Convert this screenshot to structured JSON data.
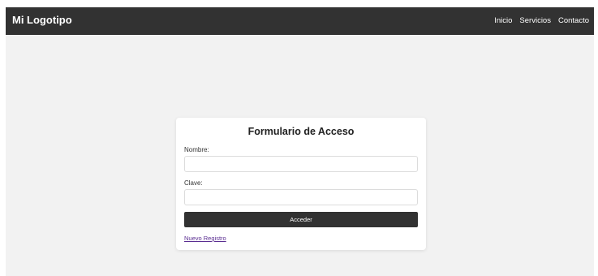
{
  "header": {
    "logo": "Mi Logotipo",
    "nav": [
      {
        "label": "Inicio"
      },
      {
        "label": "Servicios"
      },
      {
        "label": "Contacto"
      }
    ]
  },
  "form": {
    "title": "Formulario de Acceso",
    "name_label": "Nombre:",
    "name_value": "",
    "password_label": "Clave:",
    "password_value": "",
    "submit_label": "Acceder",
    "register_link": "Nuevo Registro"
  },
  "colors": {
    "navbar_bg": "#323232",
    "page_bg": "#f2f2f2",
    "card_bg": "#ffffff",
    "button_bg": "#323232",
    "link": "#5a2d91"
  }
}
